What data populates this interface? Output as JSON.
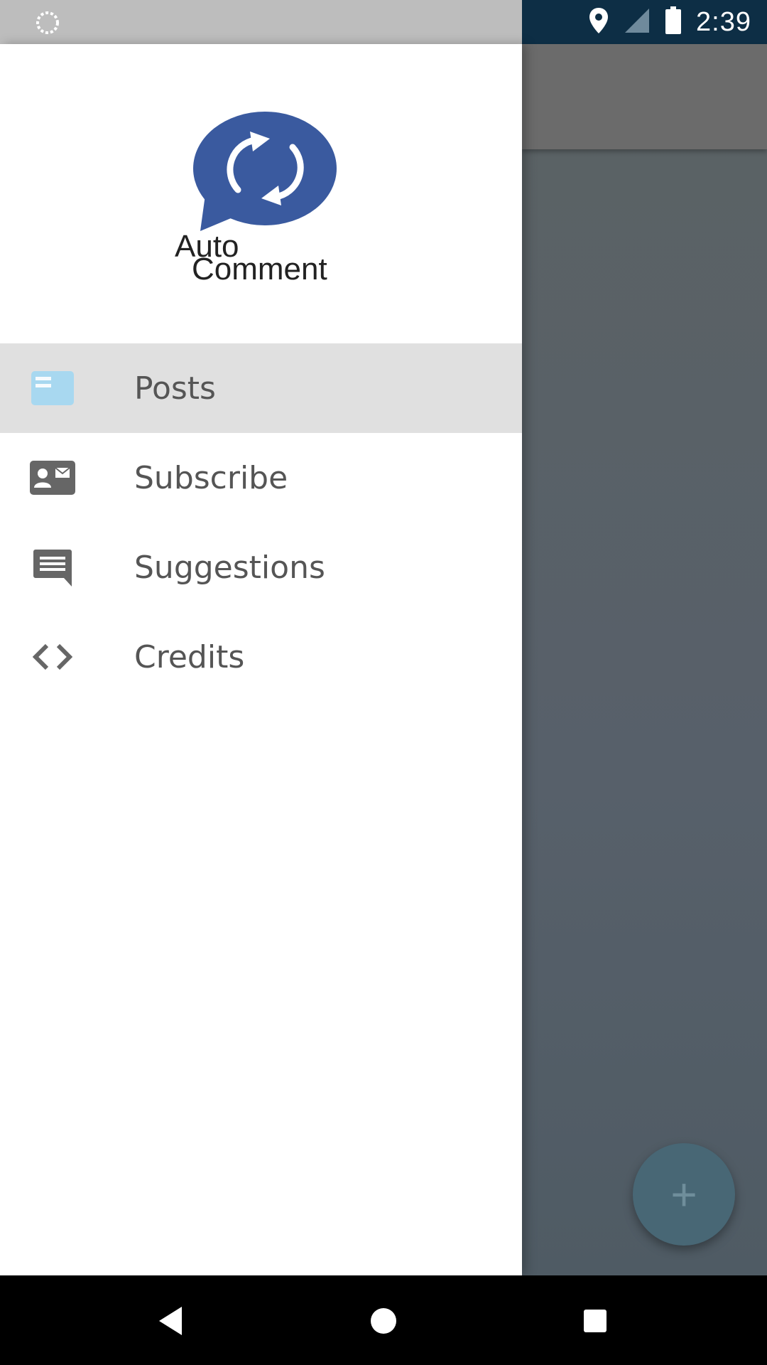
{
  "status_bar": {
    "time": "2:39",
    "icons": [
      "loading-circle-icon",
      "location-pin-icon",
      "signal-icon",
      "battery-icon"
    ]
  },
  "drawer": {
    "logo": {
      "line1": "Auto",
      "line2": "Comment",
      "brand_color": "#3a5a9f"
    },
    "items": [
      {
        "label": "Posts",
        "icon": "posts-icon",
        "active": true,
        "icon_color": "#a8d8f0"
      },
      {
        "label": "Subscribe",
        "icon": "contact-mail-icon",
        "active": false,
        "icon_color": "#666666"
      },
      {
        "label": "Suggestions",
        "icon": "chat-bubble-icon",
        "active": false,
        "icon_color": "#666666"
      },
      {
        "label": "Credits",
        "icon": "code-icon",
        "active": false,
        "icon_color": "#666666"
      }
    ]
  },
  "fab": {
    "symbol": "+",
    "icon": "plus-icon"
  },
  "navigation_bar": {
    "icons": [
      "back-icon",
      "home-icon",
      "recents-icon"
    ]
  }
}
